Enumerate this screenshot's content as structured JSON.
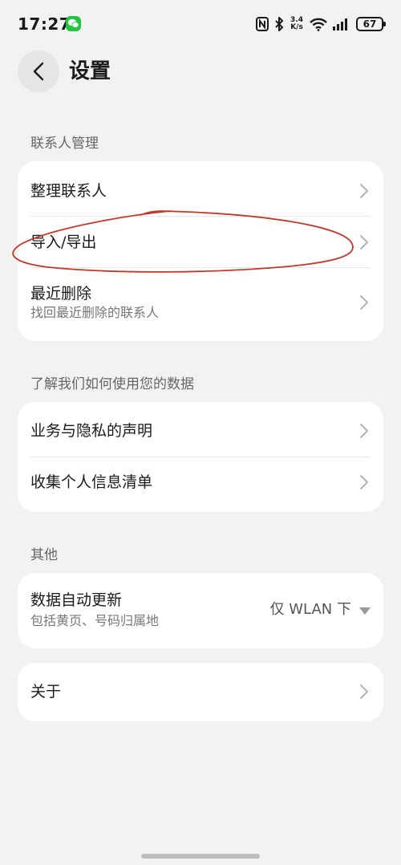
{
  "status_bar": {
    "time": "17:27",
    "net_speed_top": "3.4",
    "net_speed_bottom": "K/s",
    "battery": "67"
  },
  "header": {
    "title": "设置"
  },
  "sections": [
    {
      "header": "联系人管理",
      "items": [
        {
          "title": "整理联系人"
        },
        {
          "title": "导入/导出"
        },
        {
          "title": "最近删除",
          "subtitle": "找回最近删除的联系人"
        }
      ]
    },
    {
      "header": "了解我们如何使用您的数据",
      "items": [
        {
          "title": "业务与隐私的声明"
        },
        {
          "title": "收集个人信息清单"
        }
      ]
    },
    {
      "header": "其他",
      "items": [
        {
          "title": "数据自动更新",
          "subtitle": "包括黄页、号码归属地",
          "value": "仅 WLAN 下"
        }
      ]
    },
    {
      "header": "",
      "items": [
        {
          "title": "关于"
        }
      ]
    }
  ],
  "colors": {
    "background": "#f2f2f2",
    "card": "#ffffff",
    "annotation": "#c0392b",
    "wechat": "#23c343"
  },
  "icons": [
    "wechat-icon",
    "nfc-icon",
    "bluetooth-icon",
    "wifi-icon",
    "signal-icon",
    "battery-icon",
    "back-arrow-icon",
    "chevron-right-icon",
    "dropdown-caret-icon"
  ]
}
